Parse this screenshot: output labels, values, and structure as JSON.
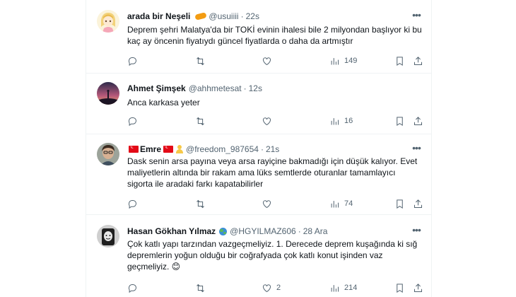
{
  "tweets": [
    {
      "name": "arada bir Neşeli",
      "handle": "@usuiiii",
      "time": "22s",
      "text": "Deprem şehri Malatya'da bir TOKİ evinin ihalesi bile 2 milyondan başlıyor ki bu kaç ay öncenin fiyatıydı güncel fiyatlarda o daha da artmıştır",
      "reply_count": "",
      "retweet_count": "",
      "like_count": "",
      "views": "149"
    },
    {
      "name": "Ahmet Şimşek",
      "handle": "@ahhmetesat",
      "time": "12s",
      "text": "Anca karkasa yeter",
      "reply_count": "",
      "retweet_count": "",
      "like_count": "",
      "views": "16"
    },
    {
      "name": "Emre",
      "handle": "@freedom_987654",
      "time": "21s",
      "text": "Dask senin arsa payına veya arsa rayiçine bakmadığı için düşük kalıyor. Evet maliyetlerin altında bir rakam ama lüks semtlerde oturanlar tamamlayıcı sigorta ile aradaki farkı kapatabilirler",
      "reply_count": "",
      "retweet_count": "",
      "like_count": "",
      "views": "74"
    },
    {
      "name": "Hasan Gökhan Yılmaz",
      "handle": "@HGYILMAZ606",
      "time": "28 Ara",
      "text": "Çok katlı yapı tarzından vazgeçmeliyiz. 1. Derecede deprem kuşağında ki sığ depremlerin yoğun olduğu bir coğrafyada çok katlı konut işinden vaz geçmeliyiz. 😊",
      "reply_count": "",
      "retweet_count": "",
      "like_count": "2",
      "views": "214"
    }
  ],
  "icons": {
    "reply": "reply-icon",
    "retweet": "retweet-icon",
    "like": "heart-icon",
    "views": "views-icon",
    "bookmark": "bookmark-icon",
    "share": "share-icon",
    "more": "more-icon"
  },
  "colors": {
    "text": "#0f1419",
    "secondary": "#536471",
    "border": "#eff3f4"
  }
}
